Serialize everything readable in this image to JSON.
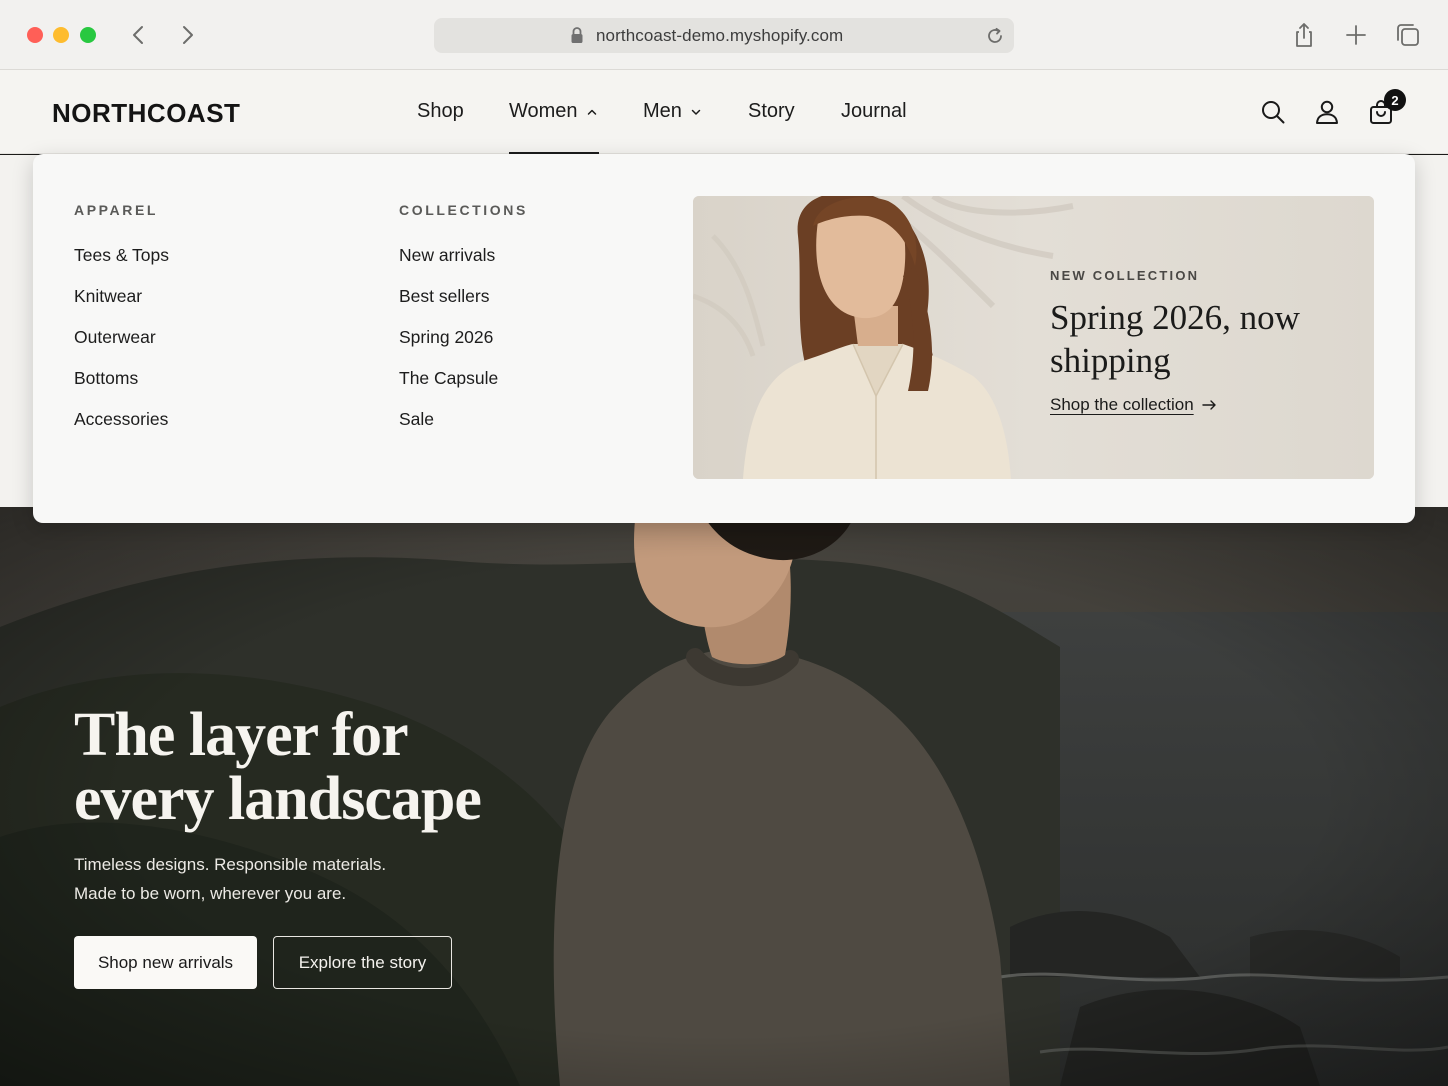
{
  "browser": {
    "url": "northcoast-demo.myshopify.com"
  },
  "header": {
    "brand": "NORTHCOAST",
    "nav": [
      {
        "label": "Shop"
      },
      {
        "label": "Women"
      },
      {
        "label": "Men"
      },
      {
        "label": "Story"
      },
      {
        "label": "Journal"
      }
    ],
    "active_nav": "Women",
    "cart_count": "2"
  },
  "mega_menu": {
    "apparel": {
      "heading": "APPAREL",
      "links": [
        "Tees & Tops",
        "Knitwear",
        "Outerwear",
        "Bottoms",
        "Accessories"
      ]
    },
    "collections": {
      "heading": "COLLECTIONS",
      "links": [
        "New arrivals",
        "Best sellers",
        "Spring 2026",
        "The Capsule",
        "Sale"
      ]
    },
    "promo": {
      "eyebrow": "NEW COLLECTION",
      "title": "Spring 2026, now shipping",
      "cta": "Shop the collection"
    }
  },
  "hero": {
    "title_line1": "The layer for",
    "title_line2": "every landscape",
    "subtitle_line1": "Timeless designs. Responsible materials.",
    "subtitle_line2": "Made to be worn, wherever you are.",
    "primary_cta": "Shop new arrivals",
    "secondary_cta": "Explore the story"
  },
  "colors": {
    "accent_dark": "#111111",
    "menu_bg": "#f8f8f7",
    "header_bg": "#f5f4f1"
  }
}
